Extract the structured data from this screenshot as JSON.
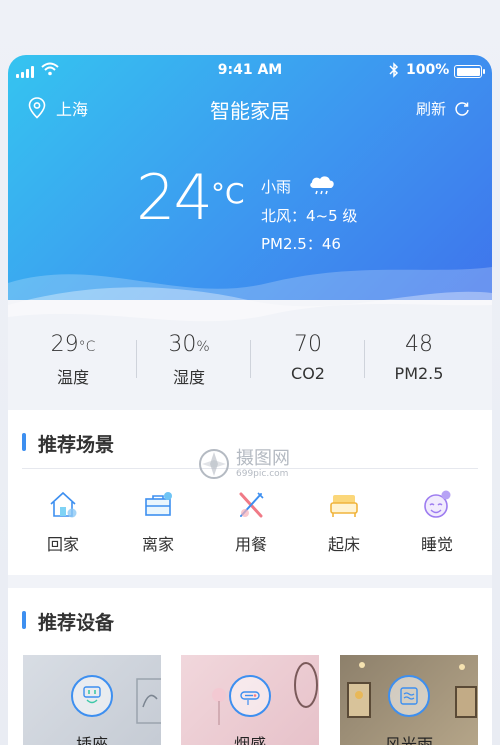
{
  "status_bar": {
    "time": "9:41 AM",
    "battery": "100%"
  },
  "nav": {
    "location": "上海",
    "title": "智能家居",
    "refresh": "刷新"
  },
  "weather": {
    "temperature": "24",
    "unit": "°C",
    "condition": "小雨",
    "wind": "北风：4~5 级",
    "pm": "PM2.5：46"
  },
  "stats": [
    {
      "value": "29",
      "unit": "°C",
      "label": "温度"
    },
    {
      "value": "30",
      "unit": "%",
      "label": "湿度"
    },
    {
      "value": "70",
      "unit": "",
      "label": "CO2"
    },
    {
      "value": "48",
      "unit": "",
      "label": "PM2.5"
    }
  ],
  "scenes": {
    "title": "推荐场景",
    "items": [
      {
        "label": "回家",
        "icon": "home-icon"
      },
      {
        "label": "离家",
        "icon": "briefcase-icon"
      },
      {
        "label": "用餐",
        "icon": "dining-icon"
      },
      {
        "label": "起床",
        "icon": "bed-icon"
      },
      {
        "label": "睡觉",
        "icon": "sleep-icon"
      }
    ]
  },
  "devices": {
    "title": "推荐设备",
    "items": [
      {
        "label": "插座",
        "icon": "socket-icon"
      },
      {
        "label": "烟感",
        "icon": "smoke-detector-icon"
      },
      {
        "label": "风光雨",
        "icon": "weather-sensor-icon"
      }
    ]
  },
  "watermark": {
    "main": "摄图网",
    "sub": "699pic.com"
  },
  "colors": {
    "accent": "#3d8ff0",
    "hero_start": "#35c4f0",
    "hero_end": "#3f74ec"
  }
}
